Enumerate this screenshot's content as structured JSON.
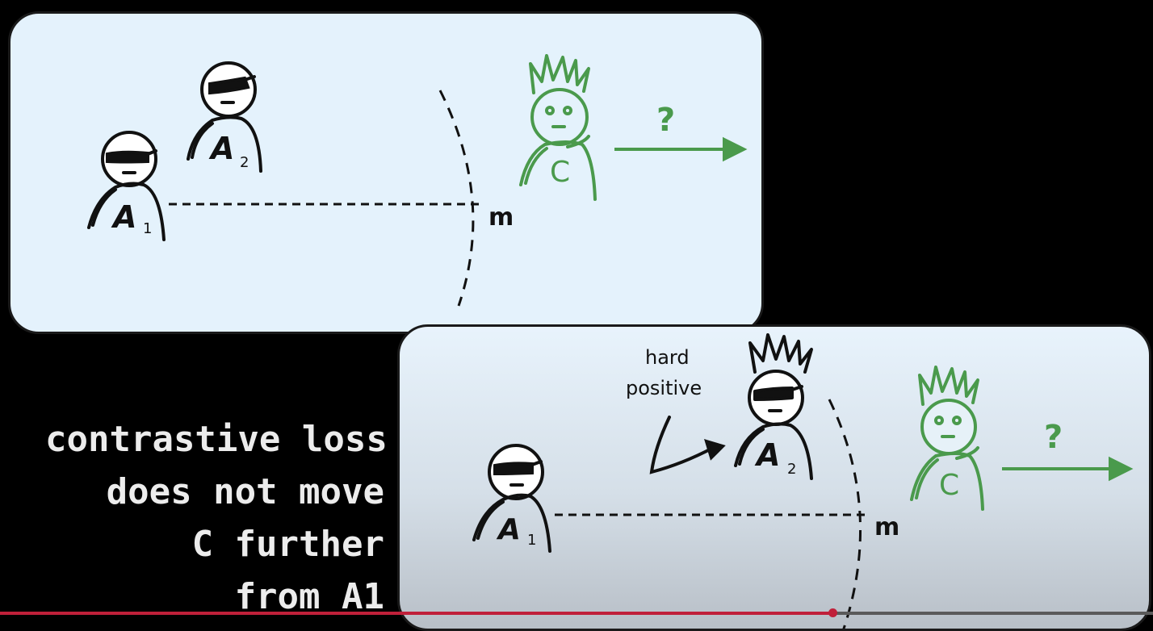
{
  "top_panel": {
    "labels": {
      "a1": "A",
      "a1_sub": "1",
      "a2": "A",
      "a2_sub": "2",
      "c": "C",
      "margin": "m",
      "question": "?"
    }
  },
  "bottom_panel": {
    "labels": {
      "a1": "A",
      "a1_sub": "1",
      "a2": "A",
      "a2_sub": "2",
      "c": "C",
      "margin": "m",
      "question": "?"
    },
    "annotation": {
      "line1": "hard",
      "line2": "positive"
    }
  },
  "caption": {
    "lines": [
      "contrastive loss",
      "does not move",
      "C further",
      "from A1"
    ]
  },
  "colors": {
    "panel_bg": "#e4f2fc",
    "green": "#4a9a4c",
    "ink": "#111111",
    "progress": "#c0203a"
  },
  "video": {
    "progress_fraction": 0.722
  }
}
